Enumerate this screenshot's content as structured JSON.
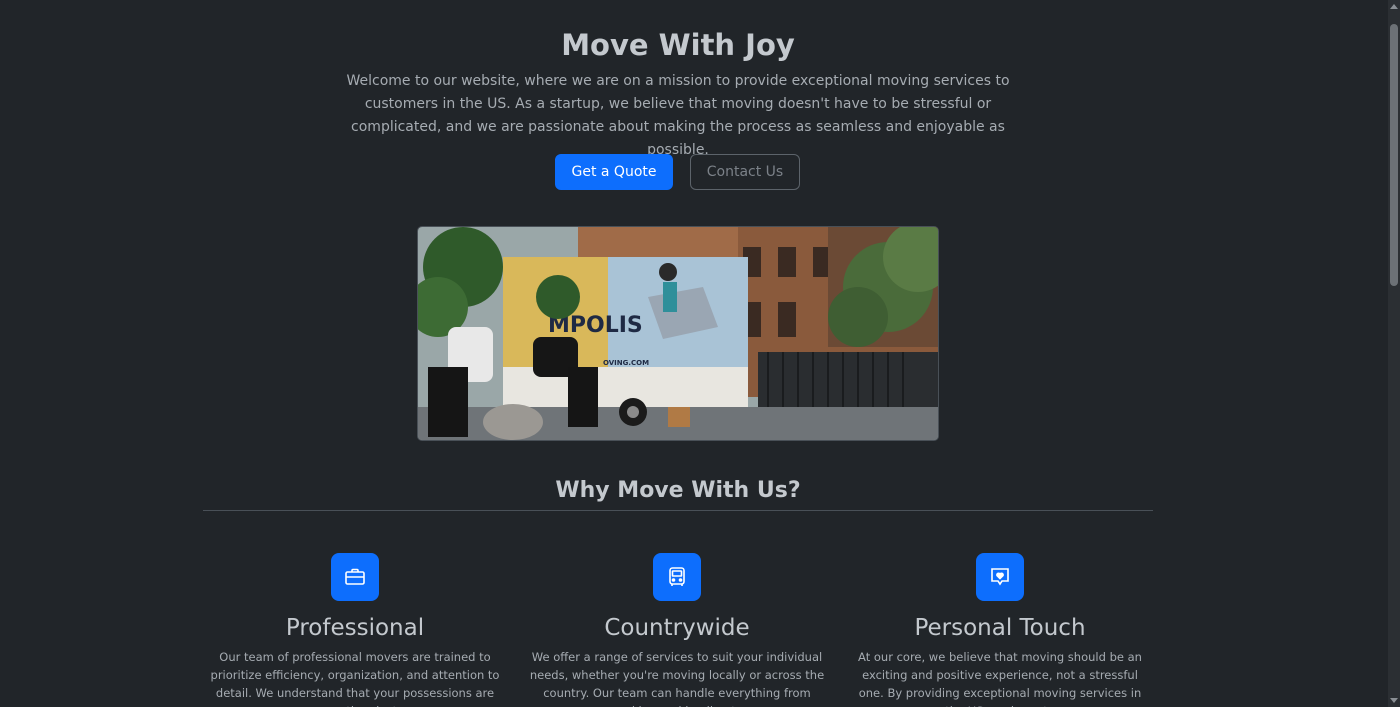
{
  "hero": {
    "title": "Move With Joy",
    "text": "Welcome to our website, where we are on a mission to provide exceptional moving services to customers in the US. As a startup, we believe that moving doesn't have to be stressful or complicated, and we are passionate about making the process as seamless and enjoyable as possible.",
    "primary_button": "Get a Quote",
    "secondary_button": "Contact Us",
    "image_truck_text": "MPOLIS",
    "image_truck_web": "OVING.COM"
  },
  "why": {
    "title": "Why Move With Us?",
    "features": [
      {
        "icon": "briefcase-icon",
        "title": "Professional",
        "text": "Our team of professional movers are trained to prioritize efficiency, organization, and attention to detail. We understand that your possessions are more than just"
      },
      {
        "icon": "bus-icon",
        "title": "Countrywide",
        "text": "We offer a range of services to suit your individual needs, whether you're moving locally or across the country. Our team can handle everything from packing and loading to"
      },
      {
        "icon": "heart-chat-icon",
        "title": "Personal Touch",
        "text": "At our core, we believe that moving should be an exciting and positive experience, not a stressful one. By providing exceptional moving services in the US, we hope to"
      }
    ]
  },
  "colors": {
    "background": "#212529",
    "accent": "#0d6efd",
    "text": "#adb5bd",
    "heading": "#c4c9ce"
  }
}
